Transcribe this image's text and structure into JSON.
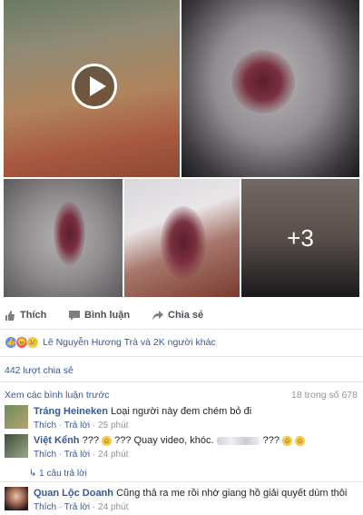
{
  "gallery": {
    "more_count": "+3"
  },
  "actions": {
    "like": "Thích",
    "comment": "Bình luận",
    "share": "Chia sẻ"
  },
  "reactions": {
    "summary": "Lê Nguyễn Hương Trà và 2K người khác"
  },
  "shares": "442 lượt chia sẻ",
  "comments_header": {
    "view_previous": "Xem các bình luận trước",
    "count": "18 trong số 678"
  },
  "comments": [
    {
      "name": "Tráng Heineken",
      "text": "Loại người này đem chém bỏ đi",
      "like": "Thích",
      "reply": "Trả lời",
      "time": "25 phút"
    },
    {
      "name": "Việt Kểnh",
      "text_start": "??? ",
      "text_mid": " ??? Quay video, khóc. ",
      "text_end": " ??? ",
      "like": "Thích",
      "reply": "Trả lời",
      "time": "24 phút"
    },
    {
      "name": "Quan Lộc Doanh",
      "text": "Cũng thả ra me rồi nhờ giang hồ giải quyết dùm thôi",
      "like": "Thích",
      "reply": "Trả lời",
      "time": "24 phút"
    }
  ],
  "reply_link": "1 câu trả lời",
  "colors": {
    "link": "#365899",
    "muted": "#90949c"
  }
}
